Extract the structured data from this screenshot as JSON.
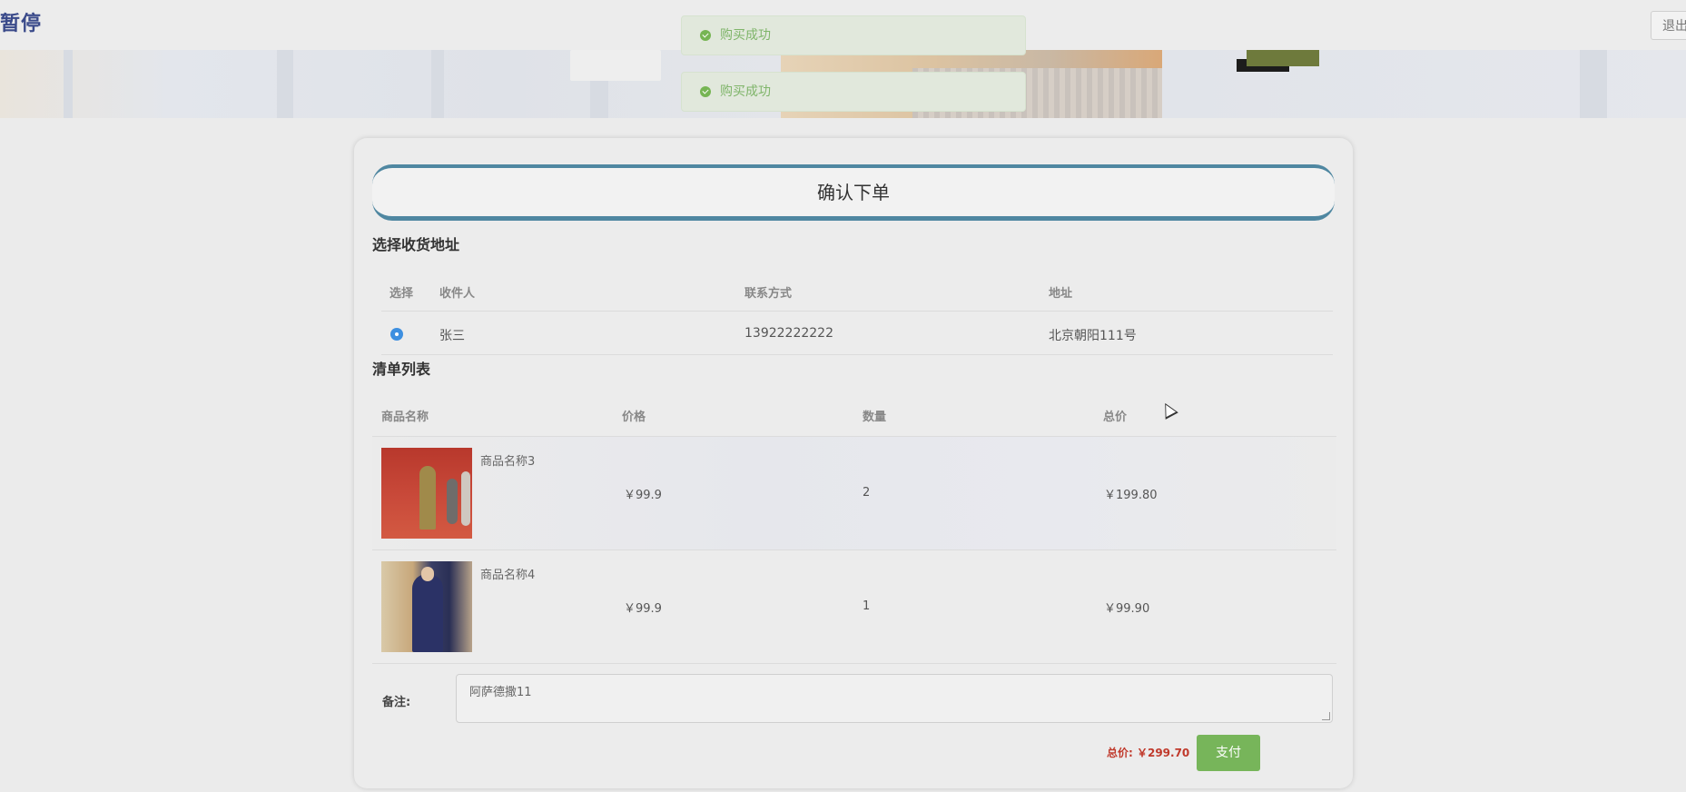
{
  "header": {
    "brand": "暂停",
    "logout_label": "退出"
  },
  "toasts": [
    {
      "text": "购买成功"
    },
    {
      "text": "购买成功"
    }
  ],
  "checkout": {
    "title": "确认下单",
    "address_section_title": "选择收货地址",
    "address_columns": [
      "选择",
      "收件人",
      "联系方式",
      "地址"
    ],
    "addresses": [
      {
        "selected": true,
        "name": "张三",
        "phone": "13922222222",
        "address": "北京朝阳111号"
      }
    ],
    "list_section_title": "清单列表",
    "item_columns": [
      "商品名称",
      "价格",
      "数量",
      "总价"
    ],
    "items": [
      {
        "name": "商品名称3",
        "price": "￥99.9",
        "qty": "2",
        "subtotal": "￥199.80"
      },
      {
        "name": "商品名称4",
        "price": "￥99.9",
        "qty": "1",
        "subtotal": "￥99.90"
      }
    ],
    "note_label": "备注:",
    "note_value": "阿萨德撒11",
    "total_text": "总价: ￥299.70",
    "pay_label": "支付"
  },
  "colors": {
    "accent": "#4f87a1",
    "pay_button": "#77b55a",
    "total_price": "#c0392b",
    "toast_text": "#7fb56a",
    "radio": "#3d8fe0"
  }
}
